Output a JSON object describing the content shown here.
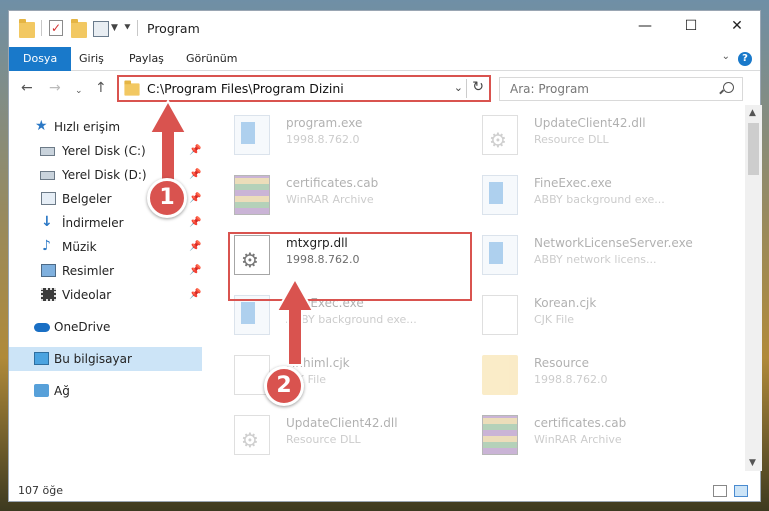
{
  "window": {
    "title": "Program"
  },
  "ribbon": {
    "tabs": [
      {
        "label": "Dosya",
        "active": true
      },
      {
        "label": "Giriş"
      },
      {
        "label": "Paylaş"
      },
      {
        "label": "Görünüm"
      }
    ]
  },
  "address": {
    "path": "C:\\Program Files\\Program Dizini"
  },
  "search": {
    "placeholder": "Ara: Program"
  },
  "sidebar": {
    "quick_access": "Hızlı erişim",
    "items": [
      {
        "label": "Yerel Disk (C:)"
      },
      {
        "label": "Yerel Disk (D:)"
      },
      {
        "label": "Belgeler"
      },
      {
        "label": "İndirmeler"
      },
      {
        "label": "Müzik"
      },
      {
        "label": "Resimler"
      },
      {
        "label": "Videolar"
      }
    ],
    "onedrive": "OneDrive",
    "this_pc": "Bu bilgisayar",
    "network": "Ağ"
  },
  "files": [
    {
      "name": "program.exe",
      "sub": "1998.8.762.0",
      "icon": "exe"
    },
    {
      "name": "UpdateClient42.dll",
      "sub": "Resource DLL",
      "icon": "dll"
    },
    {
      "name": "certificates.cab",
      "sub": "WinRAR Archive",
      "icon": "cab"
    },
    {
      "name": "FineExec.exe",
      "sub": "ABBY background exe...",
      "icon": "exe"
    },
    {
      "name": "mtxgrp.dll",
      "sub": "1998.8.762.0",
      "icon": "dll"
    },
    {
      "name": "NetworkLicenseServer.exe",
      "sub": "ABBY network licens...",
      "icon": "exe"
    },
    {
      "name": "FineExec.exe",
      "sub": "ABBY background exe...",
      "icon": "exe"
    },
    {
      "name": "Korean.cjk",
      "sub": "CJK File",
      "icon": "file"
    },
    {
      "name": "Finhiml.cjk",
      "sub": "CJK File",
      "icon": "file"
    },
    {
      "name": "Resource",
      "sub": "1998.8.762.0",
      "icon": "folder"
    },
    {
      "name": "UpdateClient42.dll",
      "sub": "Resource DLL",
      "icon": "dll"
    },
    {
      "name": "certificates.cab",
      "sub": "WinRAR Archive",
      "icon": "cab"
    }
  ],
  "status": {
    "count": "107 öğe"
  },
  "callouts": [
    "1",
    "2"
  ]
}
